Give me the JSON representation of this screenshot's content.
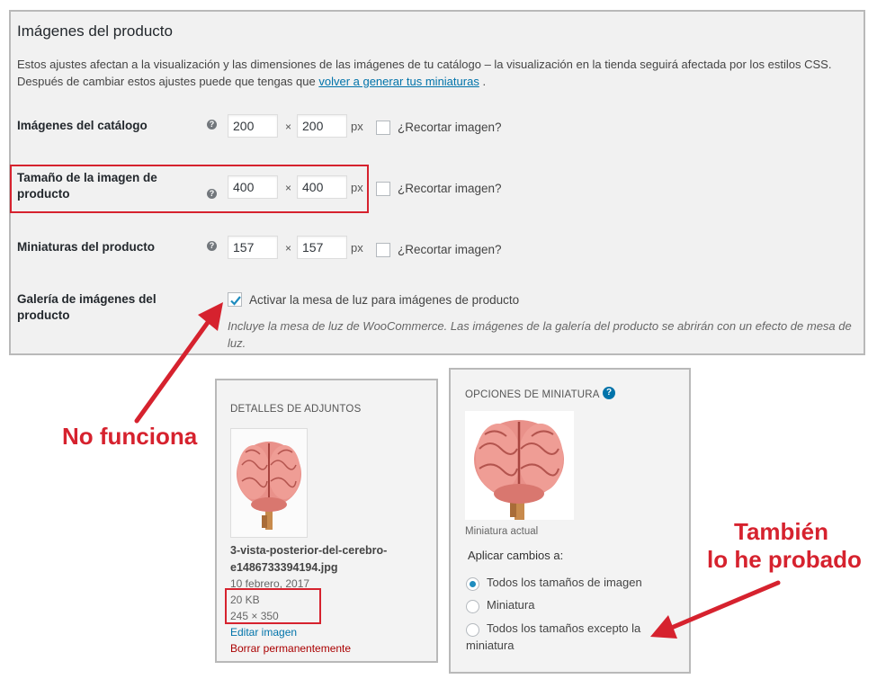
{
  "settings": {
    "title": "Imágenes del producto",
    "desc_before": "Estos ajustes afectan a la visualización y las dimensiones de las imágenes de tu catálogo – la visualización en la tienda seguirá afectada por los estilos CSS. Después de cambiar estos ajustes puede que tengas que ",
    "desc_link": "volver a generar tus miniaturas",
    "desc_after": " .",
    "times": "×",
    "px": "px",
    "crop_label": "¿Recortar imagen?",
    "help": "?",
    "rows": [
      {
        "label": "Imágenes del catálogo",
        "width": "200",
        "height": "200"
      },
      {
        "label": "Tamaño de la imagen de producto",
        "width": "400",
        "height": "400"
      },
      {
        "label": "Miniaturas del producto",
        "width": "157",
        "height": "157"
      }
    ],
    "gallery": {
      "label": "Galería de imágenes del producto",
      "checkbox_label": "Activar la mesa de luz para imágenes de producto",
      "checked": true,
      "desc": "Incluye la mesa de luz de WooCommerce. Las imágenes de la galería del producto se abrirán con un efecto de mesa de luz."
    }
  },
  "attachment": {
    "title": "DETALLES DE ADJUNTOS",
    "filename": "3-vista-posterior-del-cerebro-e1486733394194.jpg",
    "date": "10 febrero, 2017",
    "size": "20 KB",
    "dimensions": "245 × 350",
    "edit_link": "Editar imagen",
    "delete_link": "Borrar permanentemente"
  },
  "thumbnail": {
    "title": "OPCIONES DE MINIATURA",
    "help": "?",
    "current_label": "Miniatura actual",
    "apply_label": "Aplicar cambios a:",
    "options": [
      {
        "label": "Todos los tamaños de imagen",
        "selected": true
      },
      {
        "label": "Miniatura",
        "selected": false
      },
      {
        "label": "Todos los tamaños excepto la miniatura",
        "selected": false
      }
    ]
  },
  "annotations": {
    "left": "No funciona",
    "right_line1": "También",
    "right_line2": "lo he probado",
    "color": "#d6222e"
  },
  "icons": [
    "help-icon",
    "checkmark-icon",
    "brain-image",
    "arrow-icon"
  ]
}
